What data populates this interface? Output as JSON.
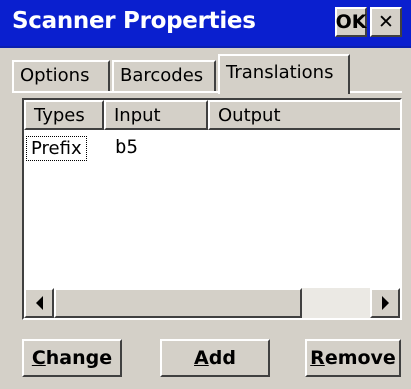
{
  "window": {
    "title": "Scanner Properties",
    "ok_label": "OK",
    "close_glyph": "✕"
  },
  "tabs": [
    {
      "label": "Options",
      "active": false
    },
    {
      "label": "Barcodes",
      "active": false
    },
    {
      "label": "Translations",
      "active": true
    }
  ],
  "list": {
    "columns": [
      "Types",
      "Input",
      "Output"
    ],
    "rows": [
      {
        "type": "Prefix",
        "input": "b5",
        "output": ""
      }
    ]
  },
  "buttons": {
    "change": {
      "accel": "C",
      "rest": "hange"
    },
    "add": {
      "accel": "A",
      "rest": "dd"
    },
    "remove": {
      "accel": "R",
      "rest": "emove"
    }
  },
  "colors": {
    "titlebar": "#0a1fcf",
    "face": "#d4d0c8",
    "list_bg": "#ffffff"
  }
}
